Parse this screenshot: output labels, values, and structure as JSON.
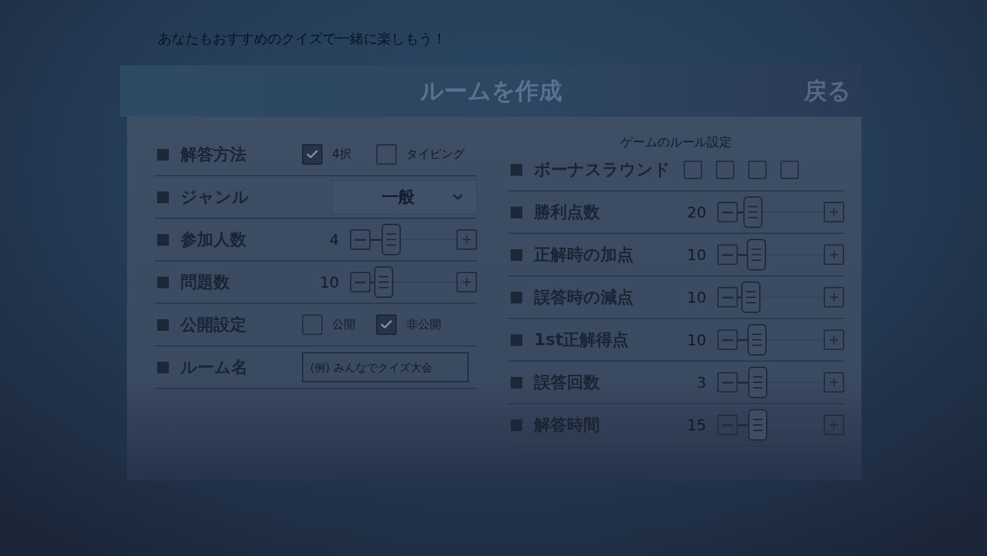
{
  "page": {
    "notice": "あなたもおすすめのクイズで一緒に楽しもう！"
  },
  "dialog": {
    "title": "ルームを作成",
    "back_label": "戻る"
  },
  "room_settings": [
    {
      "kind": "options",
      "label": "解答方法",
      "options": [
        {
          "label": "4択",
          "checked": true
        },
        {
          "label": "タイピング",
          "checked": false
        }
      ]
    },
    {
      "kind": "select",
      "label": "ジャンル",
      "value": "一般"
    },
    {
      "kind": "stepper",
      "label": "参加人数",
      "value": "4",
      "level": 0.13
    },
    {
      "kind": "stepper",
      "label": "問題数",
      "value": "10",
      "level": 0.04
    },
    {
      "kind": "options",
      "label": "公開設定",
      "options": [
        {
          "label": "公開",
          "checked": false
        },
        {
          "label": "非公開",
          "checked": true
        }
      ]
    },
    {
      "kind": "text",
      "label": "ルーム名",
      "placeholder": "(例) みんなでクイズ大会"
    }
  ],
  "rules": {
    "heading": "ゲームのルール設定",
    "items": [
      {
        "kind": "options",
        "label": "ボーナスラウンド",
        "options": [
          {
            "checked": false
          },
          {
            "checked": false
          },
          {
            "checked": false
          },
          {
            "checked": false
          }
        ]
      },
      {
        "kind": "stepper",
        "label": "勝利点数",
        "value": "20",
        "level": 0.06
      },
      {
        "kind": "stepper",
        "label": "正解時の加点",
        "value": "10",
        "level": 0.1
      },
      {
        "kind": "stepper",
        "label": "誤答時の減点",
        "value": "10",
        "level": 0.04
      },
      {
        "kind": "stepper",
        "label": "1st正解得点",
        "value": "10",
        "level": 0.11
      },
      {
        "kind": "stepper",
        "label": "誤答回数",
        "value": "3",
        "level": 0.12
      },
      {
        "kind": "stepper",
        "label": "解答時間",
        "value": "15",
        "level": 0.12
      }
    ]
  }
}
